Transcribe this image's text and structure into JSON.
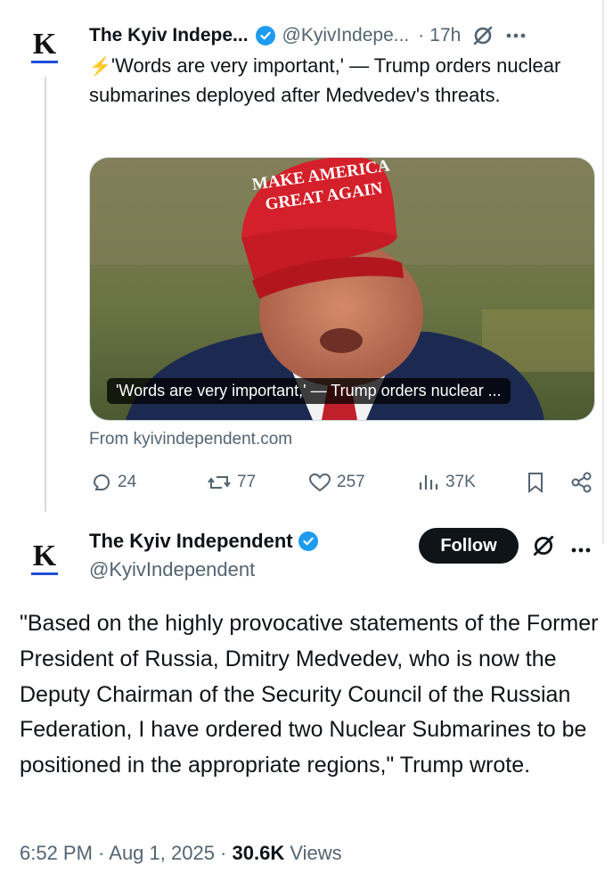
{
  "tweet1": {
    "name": "The Kyiv Indepe...",
    "handle": "@KyivIndepe...",
    "dot": "·",
    "time": "17h",
    "text": "'Words are very important,' — Trump orders nuclear submarines deployed after Medvedev's threats.",
    "bolt_emoji": "⚡",
    "card": {
      "hat_line1": "MAKE AMERICA",
      "hat_line2": "GREAT AGAIN",
      "caption": "'Words are very important,' — Trump orders nuclear ...",
      "source": "From kyivindependent.com"
    },
    "actions": {
      "replies": "24",
      "reposts": "77",
      "likes": "257",
      "views": "37K"
    }
  },
  "tweet2": {
    "name": "The Kyiv Independent",
    "handle": "@KyivIndependent",
    "follow_label": "Follow",
    "text": "\"Based on the highly provocative statements of the Former President of Russia, Dmitry Medvedev, who is now the Deputy Chairman of the Security Council of the Russian Federation, I have ordered two Nuclear Submarines to be positioned in the appropriate regions,\" Trump wrote.",
    "time": "6:52 PM · Aug 1, 2025 ·",
    "views_count": "30.6K",
    "views_label": "Views"
  },
  "avatar_letter": "K",
  "colors": {
    "verified": "#1d9bf0",
    "follow_bg": "#0f1419",
    "secondary_text": "#536471",
    "avatar_underline": "#1d4ed8"
  }
}
